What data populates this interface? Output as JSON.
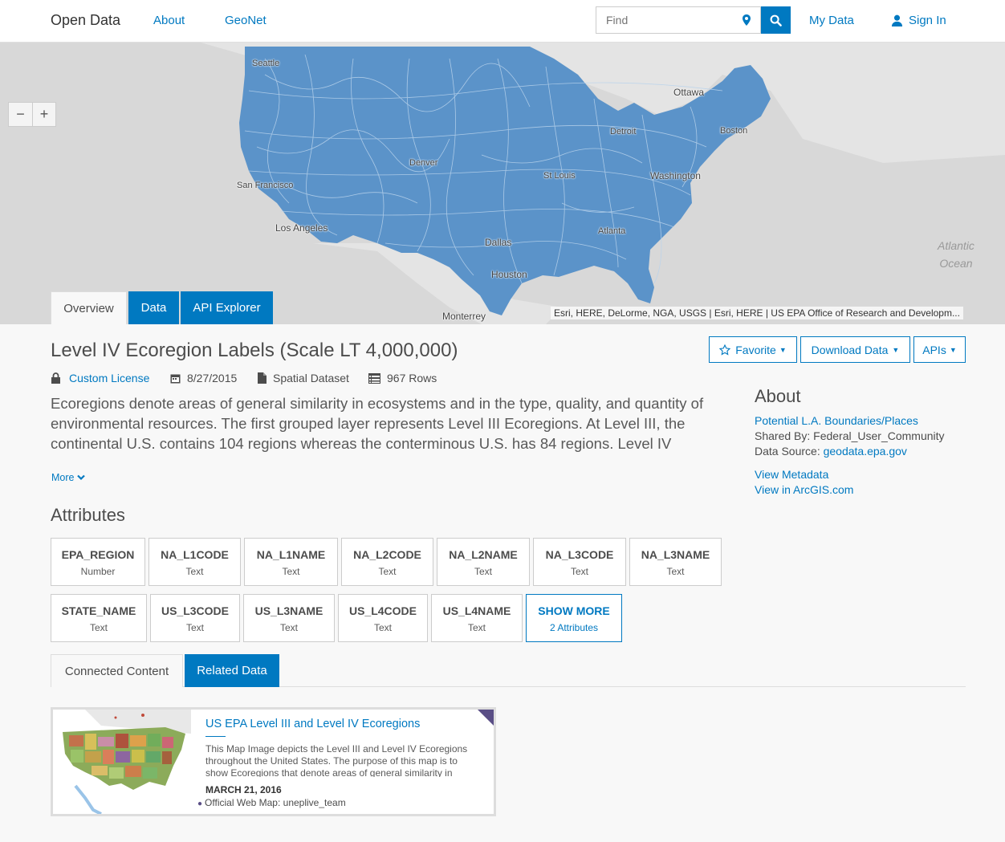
{
  "nav": {
    "brand": "Open Data",
    "links": [
      "About",
      "GeoNet"
    ],
    "search_placeholder": "Find",
    "my_data": "My Data",
    "sign_in": "Sign In"
  },
  "map": {
    "zoom_out": "−",
    "zoom_in": "+",
    "cities": [
      "Seattle",
      "Ottawa",
      "Detroit",
      "Boston",
      "Denver",
      "St Louis",
      "Washington",
      "San Francisco",
      "Los Angeles",
      "Atlanta",
      "Dallas",
      "Houston",
      "Monterrey"
    ],
    "ocean_line1": "Atlantic",
    "ocean_line2": "Ocean",
    "attribution": "Esri, HERE, DeLorme, NGA, USGS | Esri, HERE | US EPA Office of Research and Developm...",
    "region_color": "#5b93c9",
    "tabs": [
      "Overview",
      "Data",
      "API Explorer"
    ]
  },
  "dataset": {
    "title": "Level IV Ecoregion Labels (Scale LT 4,000,000)",
    "license": "Custom License",
    "date": "8/27/2015",
    "type": "Spatial Dataset",
    "rows": "967 Rows",
    "description": "Ecoregions denote areas of general similarity in ecosystems and in the type, quality, and quantity of environmental resources. The first grouped layer represents Level III Ecoregions. At Level III, the continental U.S. contains 104 regions whereas the conterminous U.S. has 84 regions. Level IV ecoregions are further subdivisions of Level III ecoregions.",
    "more": "More",
    "buttons": {
      "favorite": "Favorite",
      "download": "Download Data",
      "apis": "APIs"
    }
  },
  "about": {
    "heading": "About",
    "link": "Potential L.A. Boundaries/Places",
    "shared_by": "Shared By: Federal_User_Community",
    "source_label": "Data Source: ",
    "source_link": "geodata.epa.gov",
    "view_metadata": "View Metadata",
    "view_arcgis": "View in ArcGIS.com"
  },
  "attributes": {
    "heading": "Attributes",
    "items": [
      {
        "name": "EPA_REGION",
        "type": "Number"
      },
      {
        "name": "NA_L1CODE",
        "type": "Text"
      },
      {
        "name": "NA_L1NAME",
        "type": "Text"
      },
      {
        "name": "NA_L2CODE",
        "type": "Text"
      },
      {
        "name": "NA_L2NAME",
        "type": "Text"
      },
      {
        "name": "NA_L3CODE",
        "type": "Text"
      },
      {
        "name": "NA_L3NAME",
        "type": "Text"
      },
      {
        "name": "STATE_NAME",
        "type": "Text"
      },
      {
        "name": "US_L3CODE",
        "type": "Text"
      },
      {
        "name": "US_L3NAME",
        "type": "Text"
      },
      {
        "name": "US_L4CODE",
        "type": "Text"
      },
      {
        "name": "US_L4NAME",
        "type": "Text"
      }
    ],
    "show_more": "SHOW MORE",
    "show_more_sub": "2 Attributes"
  },
  "content_tabs": [
    "Connected Content",
    "Related Data"
  ],
  "card": {
    "title": "US EPA Level III and Level IV Ecoregions",
    "description": "This Map Image depicts the Level III and Level IV Ecoregions throughout the United States. The purpose of this map is to show Ecoregions that denote areas of general similarity in ecosystems.",
    "date": "MARCH 21, 2016",
    "type": "Official Web Map: uneplive_team"
  }
}
